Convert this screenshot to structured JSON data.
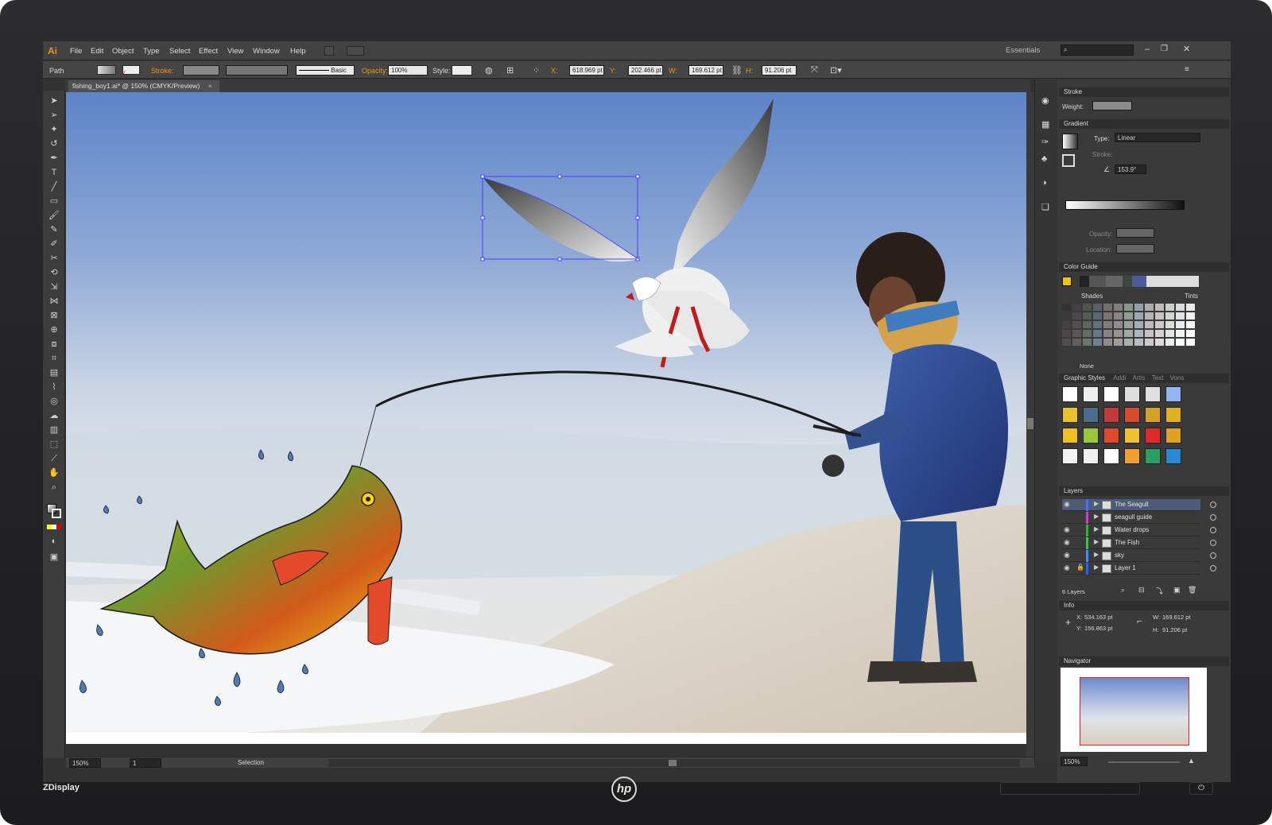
{
  "menubar": {
    "logo": "Ai",
    "items": [
      "File",
      "Edit",
      "Object",
      "Type",
      "Select",
      "Effect",
      "View",
      "Window",
      "Help"
    ],
    "workspace": "Essentials",
    "search_placeholder": ""
  },
  "control_bar": {
    "selection_type": "Path",
    "stroke_label": "Stroke:",
    "brush_label": "Basic",
    "opacity_label": "Opacity:",
    "opacity_value": "100%",
    "style_label": "Style:",
    "x_label": "X:",
    "x_value": "618.969 pt",
    "y_label": "Y:",
    "y_value": "202.466 pt",
    "w_label": "W:",
    "w_value": "169.612 pt",
    "h_label": "H:",
    "h_value": "91.206 pt"
  },
  "document": {
    "tab_title": "fishing_boy1.ai* @ 150% (CMYK/Preview)",
    "close": "×"
  },
  "status_bar": {
    "zoom": "150%",
    "artboard": "1",
    "tool": "Selection"
  },
  "panels": {
    "stroke": {
      "title": "Stroke",
      "weight_label": "Weight:"
    },
    "gradient": {
      "title": "Gradient",
      "type_label": "Type:",
      "type_value": "Linear",
      "stroke_label": "Stroke:",
      "angle_value": "153.9°",
      "opacity_label": "Opacity:",
      "location_label": "Location:"
    },
    "color_guide": {
      "title": "Color Guide",
      "shades": "Shades",
      "tints": "Tints",
      "none_label": "None"
    },
    "graphic_styles": {
      "title": "Graphic Styles",
      "tabs": [
        "Addi",
        "Artis",
        "Text",
        "Vons"
      ]
    },
    "layers": {
      "title": "Layers",
      "items": [
        {
          "name": "The Seagull",
          "color": "#4a6cff",
          "visible": true,
          "locked": false
        },
        {
          "name": "seagull guide",
          "color": "#d23cd2",
          "visible": false,
          "locked": false
        },
        {
          "name": "Water drops",
          "color": "#2fb82f",
          "visible": true,
          "locked": false
        },
        {
          "name": "The Fish",
          "color": "#3cc83c",
          "visible": true,
          "locked": false
        },
        {
          "name": "sky",
          "color": "#4b88ff",
          "visible": true,
          "locked": false
        },
        {
          "name": "Layer 1",
          "color": "#2a5cff",
          "visible": true,
          "locked": true
        }
      ],
      "count": "6 Layers"
    },
    "info": {
      "title": "Info",
      "x_label": "X:",
      "x_value": "534.163 pt",
      "y_label": "Y:",
      "y_value": "156.863 pt",
      "w_label": "W:",
      "w_value": "169.612 pt",
      "h_label": "H:",
      "h_value": "91.206 pt"
    },
    "navigator": {
      "title": "Navigator",
      "zoom": "150%"
    }
  },
  "monitor": {
    "brand": "ZDisplay",
    "logo": "hp"
  },
  "colors": {
    "accent": "#f08c1e",
    "selection": "#4a3cff",
    "panel_bg": "#3a3a3a"
  }
}
